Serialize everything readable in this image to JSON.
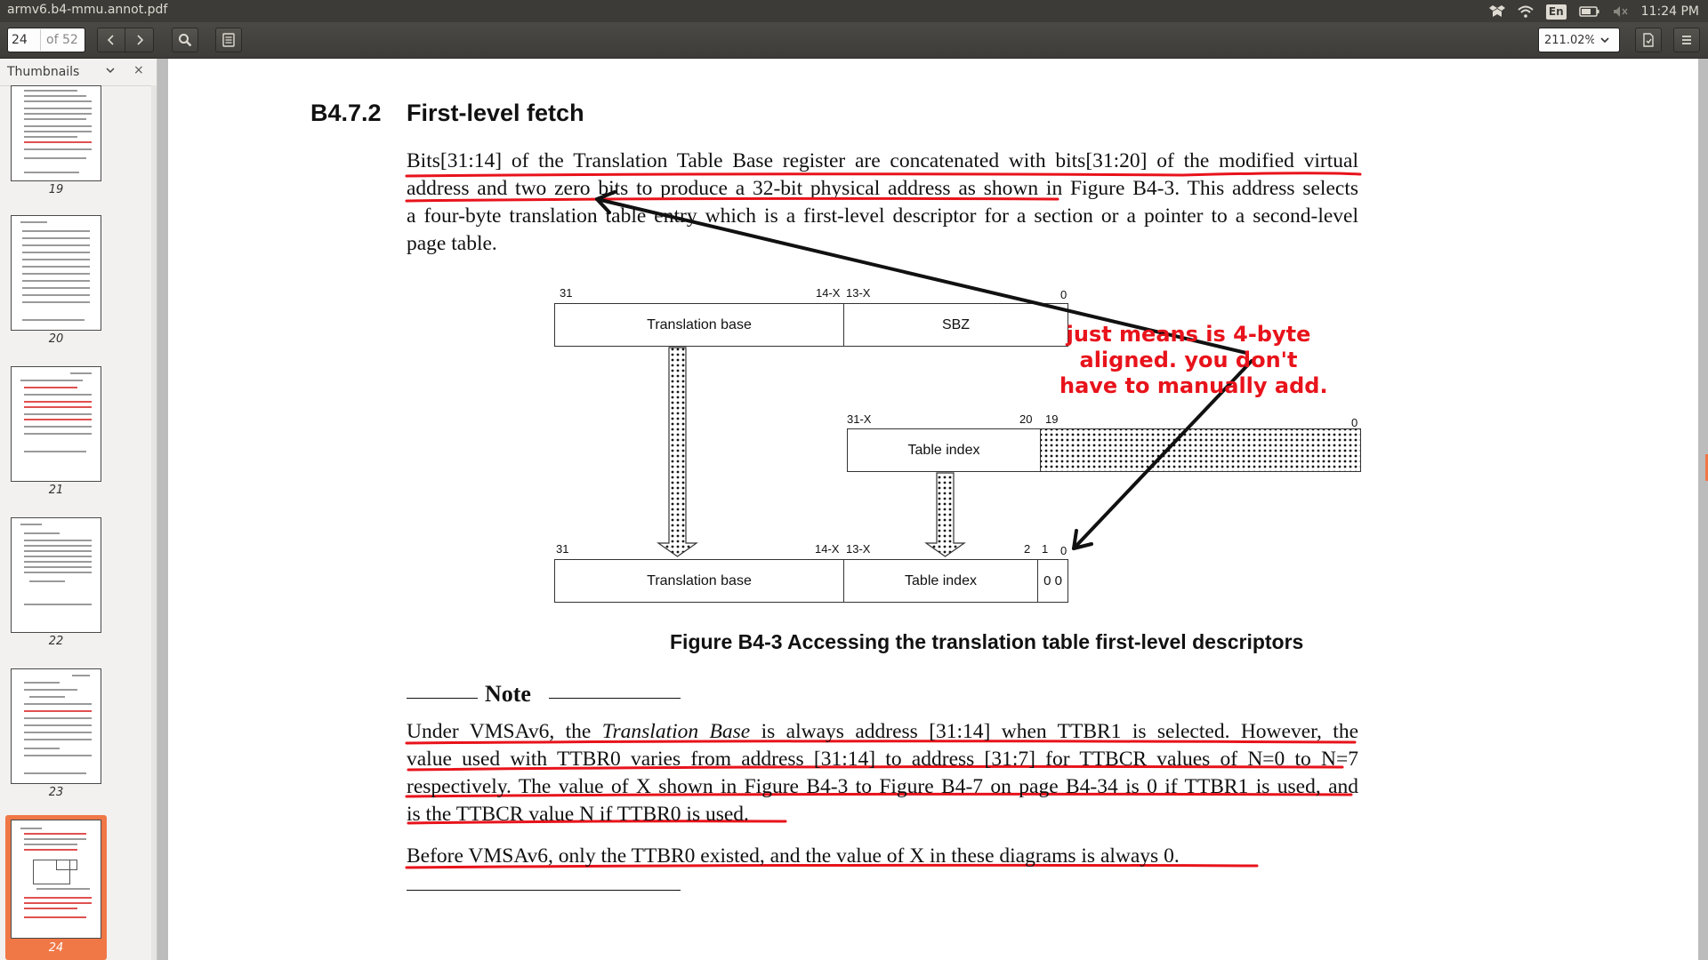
{
  "window": {
    "title": "armv6.b4-mmu.annot.pdf"
  },
  "tray": {
    "input_method": "En",
    "clock": "11:24 PM"
  },
  "toolbar": {
    "current_page": "24",
    "page_total": "of 52",
    "zoom": "211.02%"
  },
  "sidebar": {
    "title": "Thumbnails",
    "thumbnails": [
      {
        "label": "19"
      },
      {
        "label": "20"
      },
      {
        "label": "21"
      },
      {
        "label": "22"
      },
      {
        "label": "23"
      },
      {
        "label": "24",
        "selected": true
      }
    ]
  },
  "document": {
    "section_number": "B4.7.2",
    "section_title": "First-level fetch",
    "para1_lines": [
      "Bits[31:14] of the Translation Table Base register are concatenated with bits[31:20] of the modified virtual",
      "address and two zero bits to produce a 32-bit physical address as shown in Figure B4-3. This address selects",
      "a four-byte translation table entry which is a first-level descriptor for a section or a pointer to a second-level",
      "page table."
    ],
    "figure": {
      "top": {
        "b31": "31",
        "b14x": "14-X",
        "b13x": "13-X",
        "b0": "0",
        "translation_base": "Translation base",
        "sbz": "SBZ"
      },
      "middle": {
        "b31x": "31-X",
        "b20": "20",
        "b19": "19",
        "b0": "0",
        "table_index": "Table index"
      },
      "bottom": {
        "b31": "31",
        "b14x": "14-X",
        "b13x": "13-X",
        "b2": "2",
        "b1": "1",
        "b0": "0",
        "translation_base": "Translation base",
        "table_index": "Table index",
        "zeros": "0 0"
      },
      "caption": "Figure B4-3 Accessing the translation table first-level descriptors"
    },
    "note": {
      "heading": "Note",
      "para1_prefix": "Under VMSAv6, the ",
      "para1_italic": "Translation Base",
      "para1_suffix": " is always address [31:14] when TTBR1 is selected. However, the",
      "para1_lines": [
        "value used with TTBR0 varies from address [31:14] to address [31:7] for TTBCR values of N=0 to N=7",
        "respectively. The value of X shown in Figure B4-3 to Figure B4-7 on page B4-34 is 0 if TTBR1 is used, and",
        "is the TTBCR value N if TTBR0 is used."
      ],
      "para2": "Before VMSAv6, only the TTBR0 existed, and the value of X in these diagrams is always 0."
    },
    "annotation": {
      "lines": [
        "just means is 4-byte",
        "aligned.  you don't",
        "have to manually add."
      ],
      "color": "#e8131b"
    }
  },
  "colors": {
    "accent": "#f07746",
    "panel": "#3c3b37",
    "annotation": "#e8131b"
  },
  "icons": [
    "dropbox-icon",
    "wifi-icon",
    "battery-icon",
    "volume-icon",
    "chevron-left-icon",
    "chevron-right-icon",
    "search-icon",
    "sidebar-toggle-icon",
    "chevron-down-icon",
    "document-properties-icon",
    "menu-icon",
    "close-icon"
  ]
}
